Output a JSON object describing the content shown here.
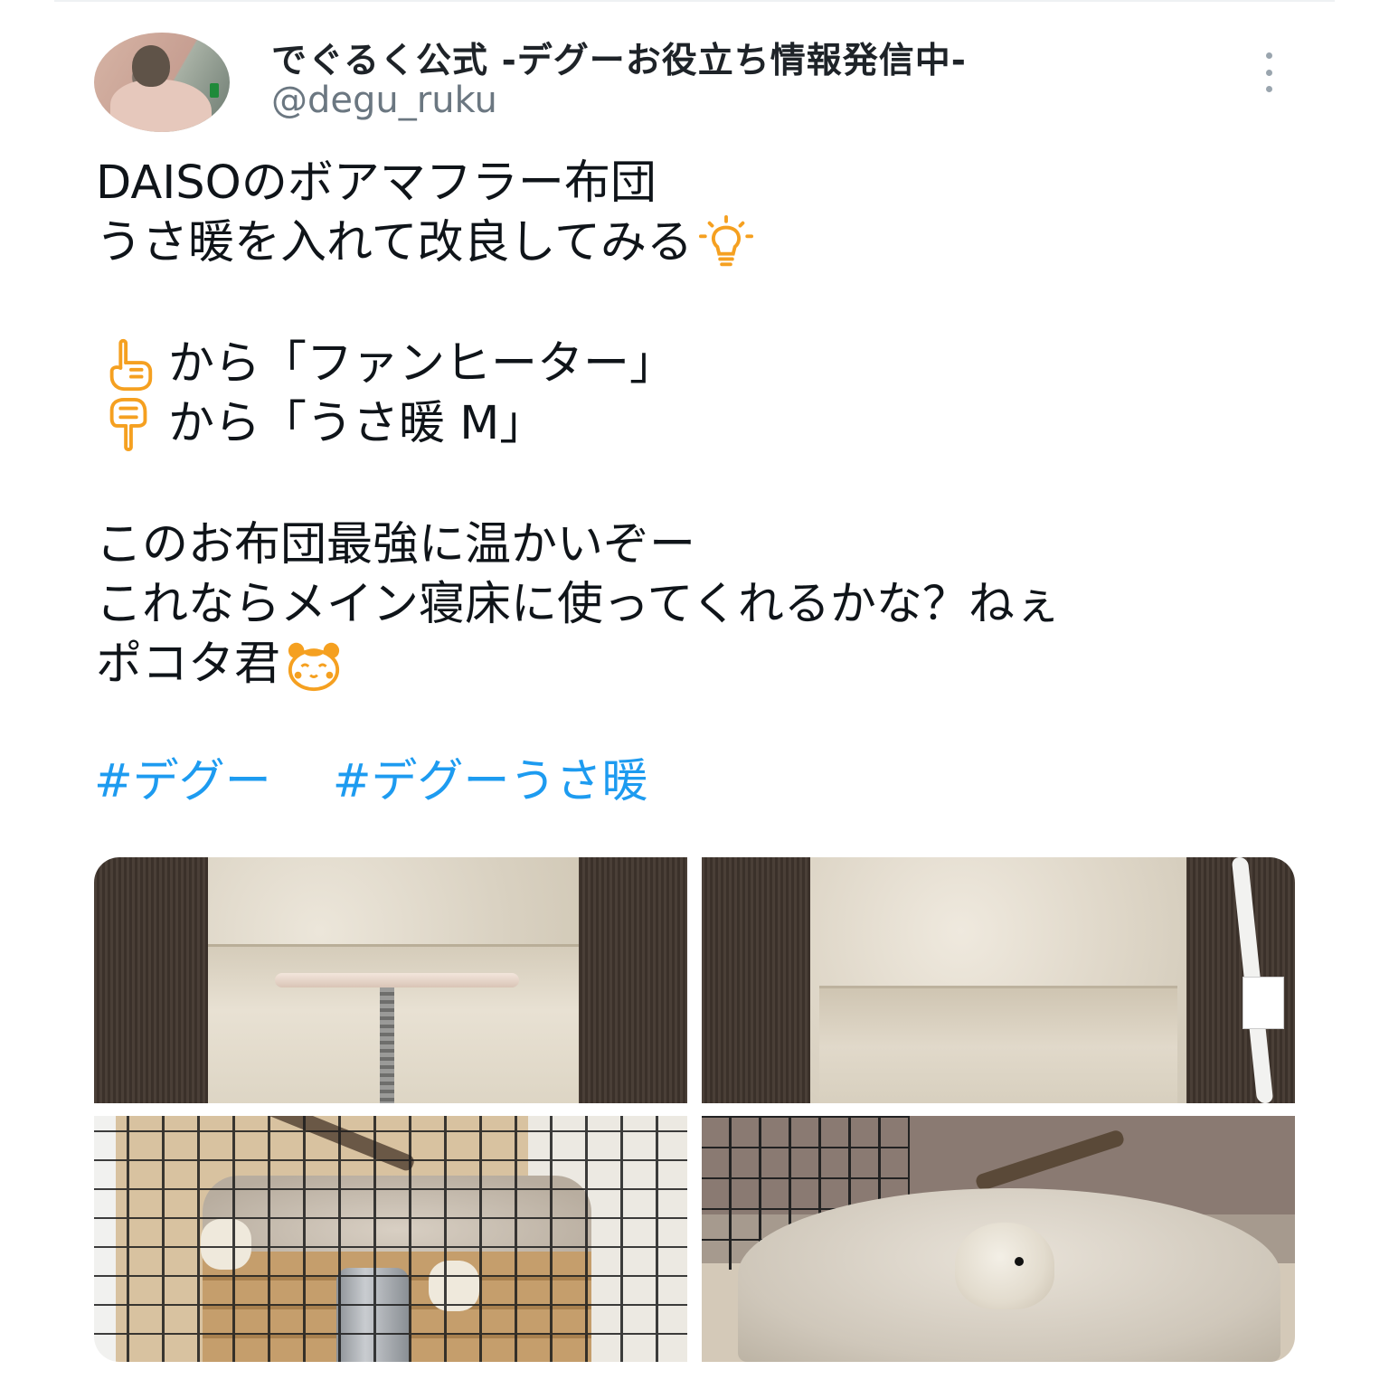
{
  "user": {
    "display_name": "でぐるく公式 -デグーお役立ち情報発信中-",
    "handle": "@degu_ruku"
  },
  "tweet": {
    "lines": [
      "DAISOのボアマフラー布団",
      "うさ暖を入れて改良してみる",
      "から「ファンヒーター」",
      "から「うさ暖 M」",
      "このお布団最強に温かいぞー",
      "これならメイン寝床に使ってくれるかな？ねぇ",
      "ポコタ君"
    ],
    "emojis": {
      "line2": "light-bulb-icon",
      "line3": "pointing-up-hand-icon",
      "line4": "pointing-down-hand-icon",
      "line7": "hamster-face-icon"
    },
    "hashtags": [
      "#デグー",
      "#デグーうさ暖"
    ]
  },
  "colors": {
    "hashtag": "#1d9bf0",
    "emoji_orange": "#f5a020",
    "handle_gray": "#6b7781"
  },
  "media": [
    {
      "name": "heater-inside-blanket-photo"
    },
    {
      "name": "blanket-closed-photo"
    },
    {
      "name": "cage-with-bed-photo"
    },
    {
      "name": "degu-in-blanket-photo"
    }
  ]
}
